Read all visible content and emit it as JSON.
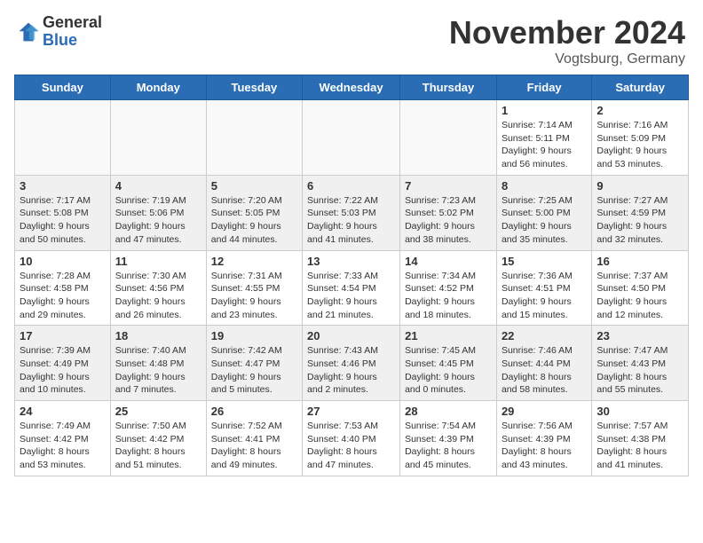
{
  "header": {
    "logo_general": "General",
    "logo_blue": "Blue",
    "month_title": "November 2024",
    "location": "Vogtsburg, Germany"
  },
  "days_of_week": [
    "Sunday",
    "Monday",
    "Tuesday",
    "Wednesday",
    "Thursday",
    "Friday",
    "Saturday"
  ],
  "weeks": [
    [
      {
        "day": "",
        "info": "",
        "empty": true
      },
      {
        "day": "",
        "info": "",
        "empty": true
      },
      {
        "day": "",
        "info": "",
        "empty": true
      },
      {
        "day": "",
        "info": "",
        "empty": true
      },
      {
        "day": "",
        "info": "",
        "empty": true
      },
      {
        "day": "1",
        "info": "Sunrise: 7:14 AM\nSunset: 5:11 PM\nDaylight: 9 hours and 56 minutes."
      },
      {
        "day": "2",
        "info": "Sunrise: 7:16 AM\nSunset: 5:09 PM\nDaylight: 9 hours and 53 minutes."
      }
    ],
    [
      {
        "day": "3",
        "info": "Sunrise: 7:17 AM\nSunset: 5:08 PM\nDaylight: 9 hours and 50 minutes."
      },
      {
        "day": "4",
        "info": "Sunrise: 7:19 AM\nSunset: 5:06 PM\nDaylight: 9 hours and 47 minutes."
      },
      {
        "day": "5",
        "info": "Sunrise: 7:20 AM\nSunset: 5:05 PM\nDaylight: 9 hours and 44 minutes."
      },
      {
        "day": "6",
        "info": "Sunrise: 7:22 AM\nSunset: 5:03 PM\nDaylight: 9 hours and 41 minutes."
      },
      {
        "day": "7",
        "info": "Sunrise: 7:23 AM\nSunset: 5:02 PM\nDaylight: 9 hours and 38 minutes."
      },
      {
        "day": "8",
        "info": "Sunrise: 7:25 AM\nSunset: 5:00 PM\nDaylight: 9 hours and 35 minutes."
      },
      {
        "day": "9",
        "info": "Sunrise: 7:27 AM\nSunset: 4:59 PM\nDaylight: 9 hours and 32 minutes."
      }
    ],
    [
      {
        "day": "10",
        "info": "Sunrise: 7:28 AM\nSunset: 4:58 PM\nDaylight: 9 hours and 29 minutes."
      },
      {
        "day": "11",
        "info": "Sunrise: 7:30 AM\nSunset: 4:56 PM\nDaylight: 9 hours and 26 minutes."
      },
      {
        "day": "12",
        "info": "Sunrise: 7:31 AM\nSunset: 4:55 PM\nDaylight: 9 hours and 23 minutes."
      },
      {
        "day": "13",
        "info": "Sunrise: 7:33 AM\nSunset: 4:54 PM\nDaylight: 9 hours and 21 minutes."
      },
      {
        "day": "14",
        "info": "Sunrise: 7:34 AM\nSunset: 4:52 PM\nDaylight: 9 hours and 18 minutes."
      },
      {
        "day": "15",
        "info": "Sunrise: 7:36 AM\nSunset: 4:51 PM\nDaylight: 9 hours and 15 minutes."
      },
      {
        "day": "16",
        "info": "Sunrise: 7:37 AM\nSunset: 4:50 PM\nDaylight: 9 hours and 12 minutes."
      }
    ],
    [
      {
        "day": "17",
        "info": "Sunrise: 7:39 AM\nSunset: 4:49 PM\nDaylight: 9 hours and 10 minutes."
      },
      {
        "day": "18",
        "info": "Sunrise: 7:40 AM\nSunset: 4:48 PM\nDaylight: 9 hours and 7 minutes."
      },
      {
        "day": "19",
        "info": "Sunrise: 7:42 AM\nSunset: 4:47 PM\nDaylight: 9 hours and 5 minutes."
      },
      {
        "day": "20",
        "info": "Sunrise: 7:43 AM\nSunset: 4:46 PM\nDaylight: 9 hours and 2 minutes."
      },
      {
        "day": "21",
        "info": "Sunrise: 7:45 AM\nSunset: 4:45 PM\nDaylight: 9 hours and 0 minutes."
      },
      {
        "day": "22",
        "info": "Sunrise: 7:46 AM\nSunset: 4:44 PM\nDaylight: 8 hours and 58 minutes."
      },
      {
        "day": "23",
        "info": "Sunrise: 7:47 AM\nSunset: 4:43 PM\nDaylight: 8 hours and 55 minutes."
      }
    ],
    [
      {
        "day": "24",
        "info": "Sunrise: 7:49 AM\nSunset: 4:42 PM\nDaylight: 8 hours and 53 minutes."
      },
      {
        "day": "25",
        "info": "Sunrise: 7:50 AM\nSunset: 4:42 PM\nDaylight: 8 hours and 51 minutes."
      },
      {
        "day": "26",
        "info": "Sunrise: 7:52 AM\nSunset: 4:41 PM\nDaylight: 8 hours and 49 minutes."
      },
      {
        "day": "27",
        "info": "Sunrise: 7:53 AM\nSunset: 4:40 PM\nDaylight: 8 hours and 47 minutes."
      },
      {
        "day": "28",
        "info": "Sunrise: 7:54 AM\nSunset: 4:39 PM\nDaylight: 8 hours and 45 minutes."
      },
      {
        "day": "29",
        "info": "Sunrise: 7:56 AM\nSunset: 4:39 PM\nDaylight: 8 hours and 43 minutes."
      },
      {
        "day": "30",
        "info": "Sunrise: 7:57 AM\nSunset: 4:38 PM\nDaylight: 8 hours and 41 minutes."
      }
    ]
  ]
}
